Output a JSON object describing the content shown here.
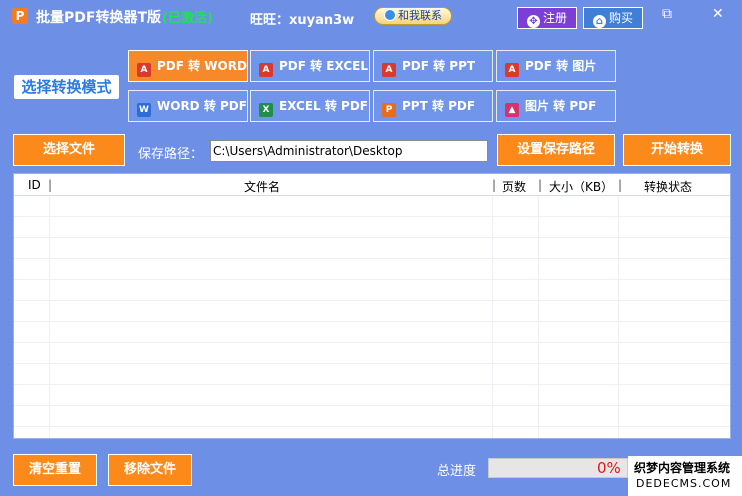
{
  "titlebar": {
    "logo": "P",
    "title": "批量PDF转换器T版",
    "edition": "(已激活)",
    "contact_label": "旺旺：xuyan3w",
    "contact_button": "和我联系",
    "register_button": "注册",
    "buy_button": "购买",
    "minimize": "⧉",
    "close": "✕"
  },
  "mode": {
    "label": "选择转换模式",
    "buttons": [
      {
        "label": "PDF 转 WORD",
        "icon": "pdf-icon",
        "active": true
      },
      {
        "label": "PDF 转 EXCEL",
        "icon": "pdf-icon"
      },
      {
        "label": "PDF 转 PPT",
        "icon": "pdf-icon"
      },
      {
        "label": "PDF 转 图片",
        "icon": "pdf-icon"
      },
      {
        "label": "WORD 转 PDF",
        "icon": "word-icon"
      },
      {
        "label": "EXCEL 转 PDF",
        "icon": "excel-icon"
      },
      {
        "label": "PPT 转 PDF",
        "icon": "ppt-icon"
      },
      {
        "label": "图片 转 PDF",
        "icon": "image-icon"
      }
    ]
  },
  "actions": {
    "select_file": "选择文件",
    "save_path_label": "保存路径：",
    "save_path_value": "C:\\Users\\Administrator\\Desktop",
    "set_save_path": "设置保存路径",
    "start_convert": "开始转换"
  },
  "table": {
    "columns": [
      "ID",
      "文件名",
      "页数",
      "大小（KB）",
      "转换状态"
    ],
    "rows": []
  },
  "footer": {
    "clear_reset": "清空重置",
    "remove_file": "移除文件",
    "progress_label": "总进度",
    "progress_value": "0%",
    "progress_fraction": 0,
    "watermark_line1": "织梦内容管理系统",
    "watermark_line2": "DEDECMS.COM"
  },
  "colors": {
    "background": "#6d8fe6",
    "accent_orange": "#f7892a",
    "edition_green": "#21e05a"
  }
}
